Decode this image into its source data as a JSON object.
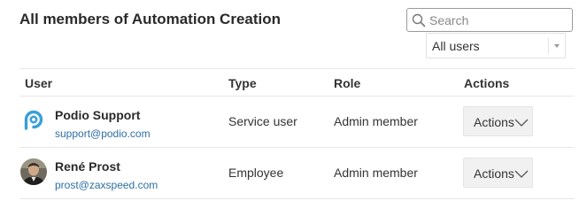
{
  "page": {
    "title": "All members of Automation Creation"
  },
  "search": {
    "placeholder": "Search",
    "icon": "search-icon"
  },
  "filter": {
    "selected": "All users"
  },
  "table": {
    "columns": {
      "user": "User",
      "type": "Type",
      "role": "Role",
      "actions": "Actions"
    },
    "rows": [
      {
        "name": "Podio Support",
        "email": "support@podio.com",
        "type": "Service user",
        "role": "Admin member",
        "action_label": "Actions",
        "avatar": "podio-logo"
      },
      {
        "name": "René Prost",
        "email": "prost@zaxspeed.com",
        "type": "Employee",
        "role": "Admin member",
        "action_label": "Actions",
        "avatar": "user-photo"
      }
    ]
  },
  "colors": {
    "link": "#2d6fa3",
    "podio_brand": "#3a9fd8",
    "divider": "#e6e6e6",
    "button_bg": "#f1f1f1"
  }
}
